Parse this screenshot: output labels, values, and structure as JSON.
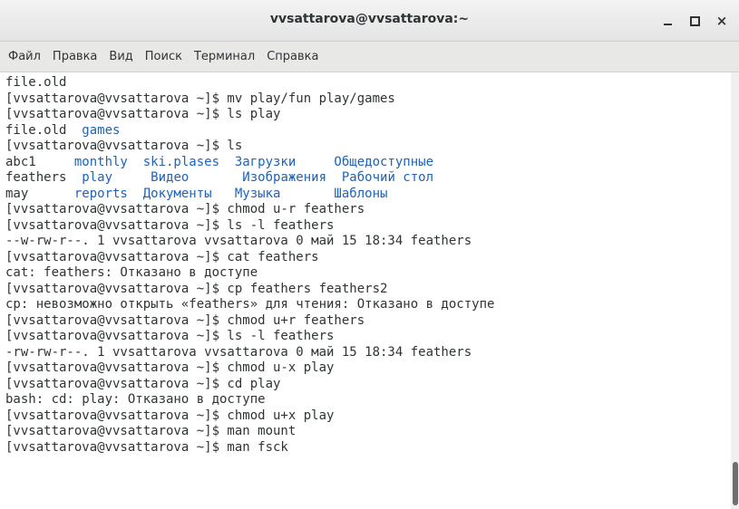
{
  "window": {
    "title": "vvsattarova@vvsattarova:~",
    "minimize_label": "_",
    "maximize_label": "□",
    "close_label": "×"
  },
  "menu": [
    "Файл",
    "Правка",
    "Вид",
    "Поиск",
    "Терминал",
    "Справка"
  ],
  "terminal": {
    "lines": [
      "file.old",
      "[vvsattarova@vvsattarova ~]$ mv play/fun play/games",
      "[vvsattarova@vvsattarova ~]$ ls play",
      "file.old  games",
      "[vvsattarova@vvsattarova ~]$ ls",
      "abc1     monthly  ski.plases  Загрузки     Общедоступные",
      "feathers  play     Видео       Изображения  Рабочий стол",
      "may      reports  Документы   Музыка       Шаблоны",
      "[vvsattarova@vvsattarova ~]$ chmod u-r feathers",
      "[vvsattarova@vvsattarova ~]$ ls -l feathers",
      "--w-rw-r--. 1 vvsattarova vvsattarova 0 май 15 18:34 feathers",
      "[vvsattarova@vvsattarova ~]$ cat feathers",
      "cat: feathers: Отказано в доступе",
      "[vvsattarova@vvsattarova ~]$ cp feathers feathers2",
      "cp: невозможно открыть «feathers» для чтения: Отказано в доступе",
      "[vvsattarova@vvsattarova ~]$ chmod u+r feathers",
      "[vvsattarova@vvsattarova ~]$ ls -l feathers",
      "-rw-rw-r--. 1 vvsattarova vvsattarova 0 май 15 18:34 feathers",
      "[vvsattarova@vvsattarova ~]$ chmod u-x play",
      "[vvsattarova@vvsattarova ~]$ cd play",
      "bash: cd: play: Отказано в доступе",
      "[vvsattarova@vvsattarova ~]$ chmod u+x play",
      "[vvsattarova@vvsattarova ~]$ man mount",
      "[vvsattarova@vvsattarova ~]$ man fsck"
    ],
    "colored_lines": {
      "3": [
        [
          "file.old  ",
          "plain"
        ],
        [
          "games",
          "dir"
        ]
      ],
      "5": [
        [
          "abc1     ",
          "plain"
        ],
        [
          "monthly  ski.plases  Загрузки     Общедоступные",
          "dir"
        ]
      ],
      "6": [
        [
          "feathers  ",
          "plain"
        ],
        [
          "play     Видео       Изображения  Рабочий стол",
          "dir"
        ]
      ],
      "7": [
        [
          "may      ",
          "plain"
        ],
        [
          "reports  Документы   Музыка       Шаблоны",
          "dir"
        ]
      ]
    },
    "directory_color": "#1f63b5",
    "text_color": "#2e3436"
  }
}
